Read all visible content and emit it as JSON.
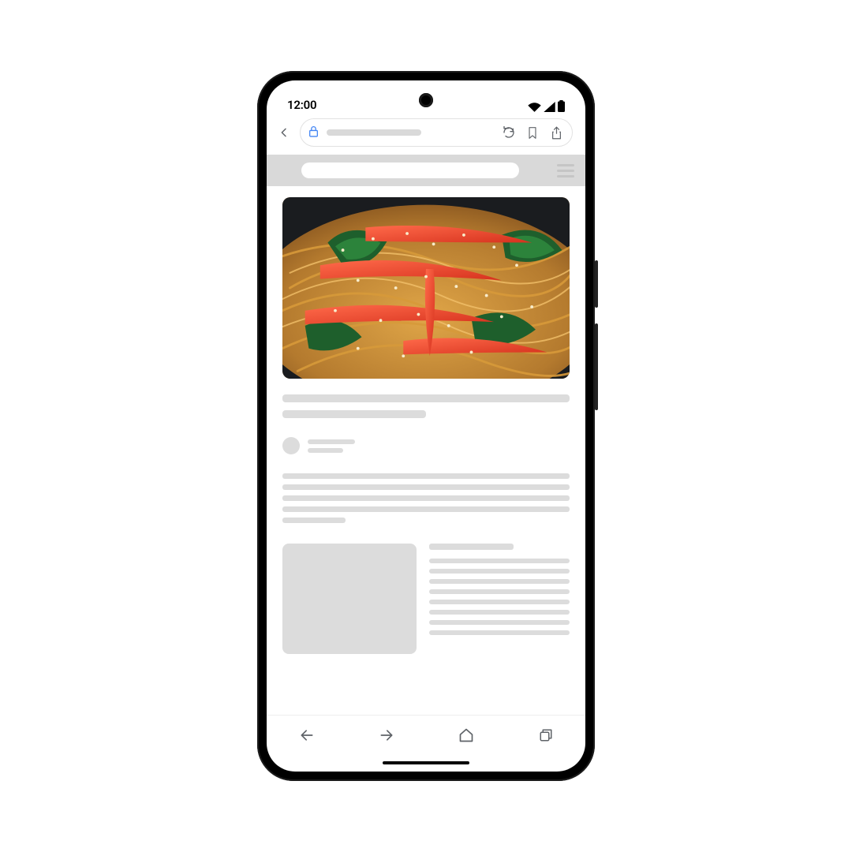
{
  "statusbar": {
    "time": "12:00",
    "wifi_icon": "wifi",
    "signal_icon": "cellular",
    "battery_icon": "battery"
  },
  "browser": {
    "back_label": "Back",
    "lock_label": "Secure",
    "reload_label": "Reload",
    "bookmark_label": "Bookmark",
    "share_label": "Share"
  },
  "site": {
    "menu_label": "Menu"
  },
  "hero": {
    "alt": "Japchae — Korean stir-fried glass noodles with spinach, red pepper strips and sesame seeds"
  },
  "bottom_nav": {
    "back_label": "Back",
    "forward_label": "Forward",
    "home_label": "Home",
    "tabs_label": "Tabs"
  }
}
